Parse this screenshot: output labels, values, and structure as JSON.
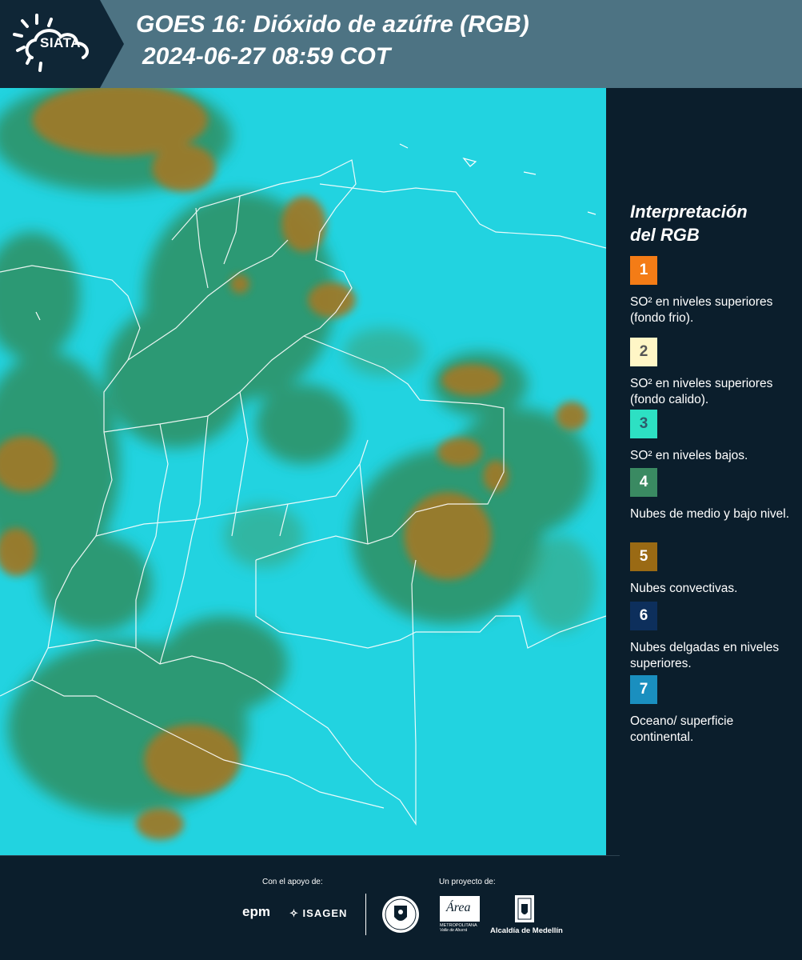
{
  "header": {
    "logo_text": "SIATA",
    "title_line1": "GOES 16: Dióxido de azúfre (RGB)",
    "title_line2": "2024-06-27 08:59 COT"
  },
  "map": {
    "icon": "satellite-rgb-map",
    "colors": {
      "surface": "#22d3e0",
      "green": "#2f8f62",
      "brown": "#9c7a2a"
    }
  },
  "legend": {
    "title_line1": "Interpretación",
    "title_line2": "del RGB",
    "items": [
      {
        "number": "1",
        "label": "SO² en niveles superiores (fondo frio).",
        "color": "#f47c16",
        "text_color": "#ffffff"
      },
      {
        "number": "2",
        "label": "SO² en niveles superiores (fondo calido).",
        "color": "#fff6c6",
        "text_color": "#555555"
      },
      {
        "number": "3",
        "label": "SO² en niveles bajos.",
        "color": "#2de0c3",
        "text_color": "#2e5a6a"
      },
      {
        "number": "4",
        "label": "Nubes de medio y bajo nivel.",
        "color": "#3a8a62",
        "text_color": "#ffffff"
      },
      {
        "number": "5",
        "label": "Nubes convectivas.",
        "color": "#9a6a14",
        "text_color": "#ffffff"
      },
      {
        "number": "6",
        "label": "Nubes delgadas en niveles superiores.",
        "color": "#0d2f5c",
        "text_color": "#ffffff"
      },
      {
        "number": "7",
        "label": "Oceano/ superficie continental.",
        "color": "#1a8fbf",
        "text_color": "#ffffff"
      }
    ]
  },
  "footer": {
    "support_label": "Con el apoyo de:",
    "project_label": "Un proyecto de:",
    "epm": "epm",
    "isagen": "ISAGEN",
    "area_logo_text": "Área",
    "area_subtext": "METROPOLITANA",
    "area_subtext2": "Valle de Aburrá",
    "alcaldia": "Alcaldía de Medellín"
  }
}
